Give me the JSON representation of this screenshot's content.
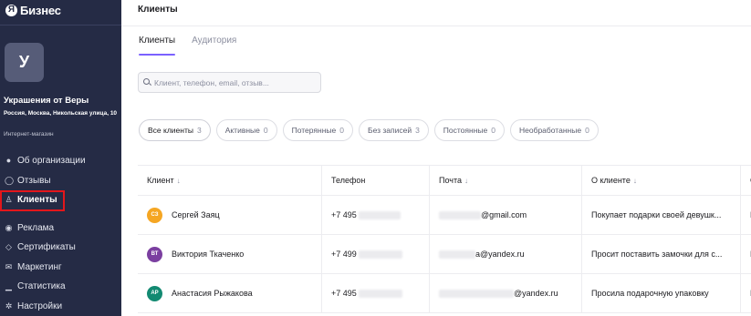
{
  "sidebar": {
    "logo_mark": "Я",
    "logo_text": "Бизнес",
    "org": {
      "avatar_letter": "У",
      "name": "Украшения от Веры",
      "address": "Россия, Москва, Никольская улица, 10",
      "type": "Интернет-магазин"
    },
    "nav": [
      {
        "label": "Об организации",
        "icon": "info-icon",
        "glyph": "●"
      },
      {
        "label": "Отзывы",
        "icon": "chat-icon",
        "glyph": "◯"
      },
      {
        "label": "Клиенты",
        "icon": "person-icon",
        "glyph": "♙"
      },
      {
        "label": "Реклама",
        "icon": "megaphone-icon",
        "glyph": "◉"
      },
      {
        "label": "Сертификаты",
        "icon": "tag-icon",
        "glyph": "◇"
      },
      {
        "label": "Маркетинг",
        "icon": "mail-icon",
        "glyph": "✉"
      },
      {
        "label": "Статистика",
        "icon": "bar-chart-icon",
        "glyph": "▁"
      },
      {
        "label": "Настройки",
        "icon": "gear-icon",
        "glyph": "✲"
      }
    ],
    "active_index": 2
  },
  "main": {
    "title": "Клиенты",
    "tabs": [
      {
        "label": "Клиенты",
        "active": true
      },
      {
        "label": "Аудитория",
        "active": false
      }
    ],
    "search": {
      "placeholder": "Клиент, телефон, email, отзыв..."
    },
    "filters": [
      {
        "label": "Все клиенты",
        "count": "3",
        "active": true
      },
      {
        "label": "Активные",
        "count": "0",
        "active": false
      },
      {
        "label": "Потерянные",
        "count": "0",
        "active": false
      },
      {
        "label": "Без записей",
        "count": "3",
        "active": false
      },
      {
        "label": "Постоянные",
        "count": "0",
        "active": false
      },
      {
        "label": "Необработанные",
        "count": "0",
        "active": false
      }
    ],
    "table": {
      "columns": [
        {
          "label": "Клиент",
          "sortable": true
        },
        {
          "label": "Телефон",
          "sortable": false
        },
        {
          "label": "Почта",
          "sortable": true
        },
        {
          "label": "О клиенте",
          "sortable": true
        },
        {
          "label": "С",
          "sortable": false
        }
      ],
      "sort_glyph": "↓",
      "rows": [
        {
          "initials": "СЗ",
          "avatar_color": "#f5a623",
          "name": "Сергей Заяц",
          "phone_prefix": "+7 495",
          "email_suffix": "@gmail.com",
          "about": "Покупает подарки своей девушк...",
          "extra": "Е"
        },
        {
          "initials": "ВТ",
          "avatar_color": "#7b3fa0",
          "name": "Виктория Ткаченко",
          "phone_prefix": "+7 499",
          "email_suffix": "a@yandex.ru",
          "about": "Просит поставить замочки для с...",
          "extra": "Е"
        },
        {
          "initials": "АР",
          "avatar_color": "#138a72",
          "name": "Анастасия Рыжакова",
          "phone_prefix": "+7 495",
          "email_suffix": "@yandex.ru",
          "about": "Просила подарочную упаковку",
          "extra": "Е"
        }
      ]
    }
  },
  "colors": {
    "sidebar_bg": "#252b45",
    "accent": "#7b61ff",
    "highlight": "#e3161b"
  }
}
